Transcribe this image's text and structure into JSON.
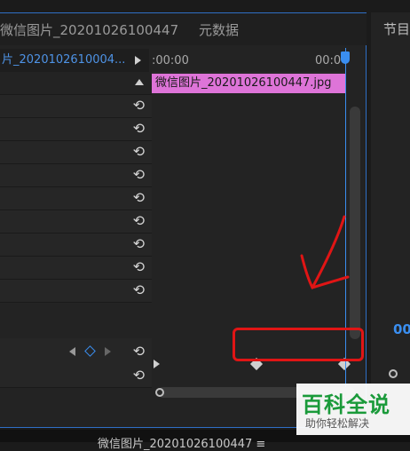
{
  "tabs": {
    "active": "微信图片_20201026100447",
    "metadata": "元数据"
  },
  "clip": {
    "name": "片_2020102610004...",
    "bar_label": "微信图片_20201026100447.jpg"
  },
  "timeline": {
    "time_start": ":00:00",
    "time_end": "00:0"
  },
  "right_panel": {
    "title": "节目",
    "value": "00"
  },
  "bottom": {
    "label": "微信图片_20201026100447 ≡"
  },
  "watermark": {
    "title": "百科全说",
    "subtitle": "助你轻松解决"
  },
  "icons": {
    "reset": "reset-icon",
    "play": "play-icon",
    "scroll_up": "scroll-up-icon"
  },
  "colors": {
    "accent": "#3a8ef0",
    "clip": "#de74d8",
    "annotation": "#e01515"
  }
}
